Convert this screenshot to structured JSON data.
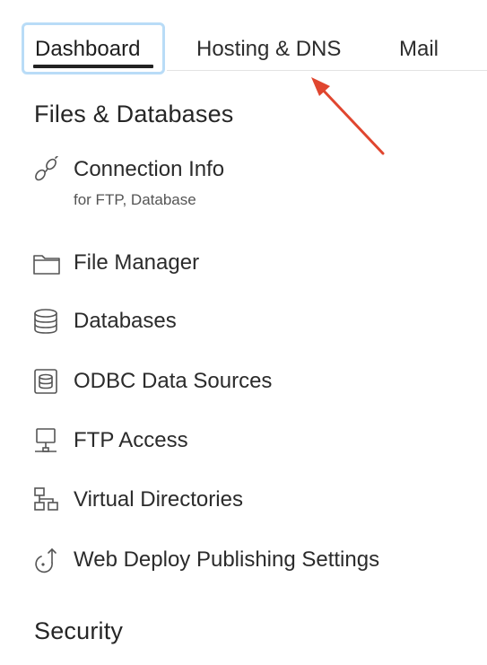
{
  "tabs": {
    "items": [
      {
        "label": "Dashboard",
        "active": true
      },
      {
        "label": "Hosting & DNS",
        "active": false
      },
      {
        "label": "Mail",
        "active": false
      }
    ]
  },
  "sections": [
    {
      "heading": "Files & Databases",
      "items": [
        {
          "label": "Connection Info",
          "sublabel": "for FTP, Database",
          "icon": "connection-link-icon"
        },
        {
          "label": "File Manager",
          "icon": "folder-icon"
        },
        {
          "label": "Databases",
          "icon": "database-icon"
        },
        {
          "label": "ODBC Data Sources",
          "icon": "odbc-data-source-icon"
        },
        {
          "label": "FTP Access",
          "icon": "ftp-access-icon"
        },
        {
          "label": "Virtual Directories",
          "icon": "virtual-directories-icon"
        },
        {
          "label": "Web Deploy Publishing Settings",
          "icon": "web-deploy-icon"
        }
      ]
    },
    {
      "heading": "Security",
      "items": []
    }
  ],
  "colors": {
    "active_tab_focus_ring": "#b9dcf7",
    "annotation_arrow": "#e0462f",
    "text": "#2b2b2b"
  }
}
